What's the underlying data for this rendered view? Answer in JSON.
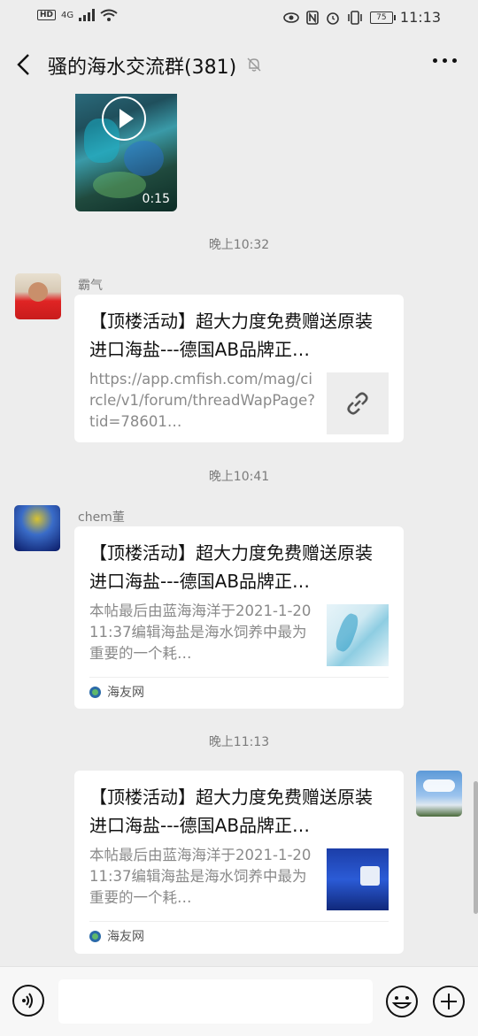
{
  "status_bar": {
    "hd": "HD",
    "network": "4G",
    "battery": "75",
    "time": "11:13"
  },
  "header": {
    "title": "骚的海水交流群(381)"
  },
  "video": {
    "duration": "0:15"
  },
  "messages": [
    {
      "timestamp": "晚上10:32",
      "sender": "霸气",
      "title": "【顶楼活动】超大力度免费赠送原装进口海盐---德国AB品牌正…",
      "desc": "https://app.cmfish.com/mag/circle/v1/forum/threadWapPage?tid=78601…"
    },
    {
      "timestamp": "晚上10:41",
      "sender": "chem董",
      "title": "【顶楼活动】超大力度免费赠送原装进口海盐---德国AB品牌正…",
      "desc": "本帖最后由蓝海海洋于2021-1-2011:37编辑海盐是海水饲养中最为重要的一个耗…",
      "source": "海友网"
    },
    {
      "timestamp": "晚上11:13",
      "title": "【顶楼活动】超大力度免费赠送原装进口海盐---德国AB品牌正…",
      "desc": "本帖最后由蓝海海洋于2021-1-2011:37编辑海盐是海水饲养中最为重要的一个耗…",
      "source": "海友网"
    }
  ],
  "input": {
    "placeholder": ""
  }
}
